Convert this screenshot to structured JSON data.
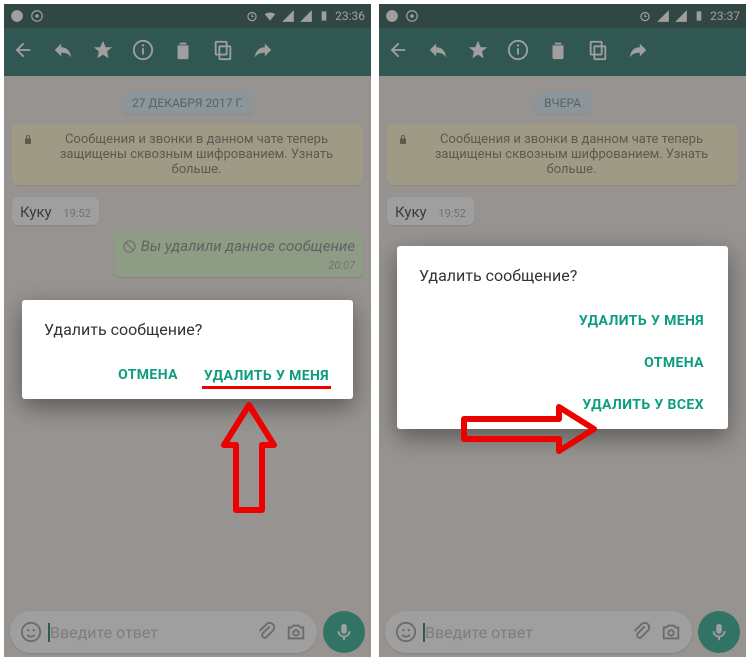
{
  "left": {
    "time": "23:36",
    "date_badge": "27 ДЕКАБРЯ 2017 Г.",
    "banner": "Сообщения и звонки в данном чате теперь защищены сквозным шифрованием. Узнать больше.",
    "msg_in": "Куку",
    "msg_in_time": "19:52",
    "msg_out": "Вы удалили данное сообщение",
    "msg_out_time": "20:07",
    "input_placeholder": "Введите ответ",
    "dialog": {
      "title": "Удалить сообщение?",
      "cancel": "ОТМЕНА",
      "del_me": "УДАЛИТЬ У МЕНЯ"
    }
  },
  "right": {
    "time": "23:37",
    "date_badge": "ВЧЕРА",
    "banner": "Сообщения и звонки в данном чате теперь защищены сквозным шифрованием. Узнать больше.",
    "msg_in": "Куку",
    "msg_in_time": "19:52",
    "input_placeholder": "Введите ответ",
    "dialog": {
      "title": "Удалить сообщение?",
      "del_me": "УДАЛИТЬ У МЕНЯ",
      "cancel": "ОТМЕНА",
      "del_all": "УДАЛИТЬ У ВСЕХ"
    }
  }
}
